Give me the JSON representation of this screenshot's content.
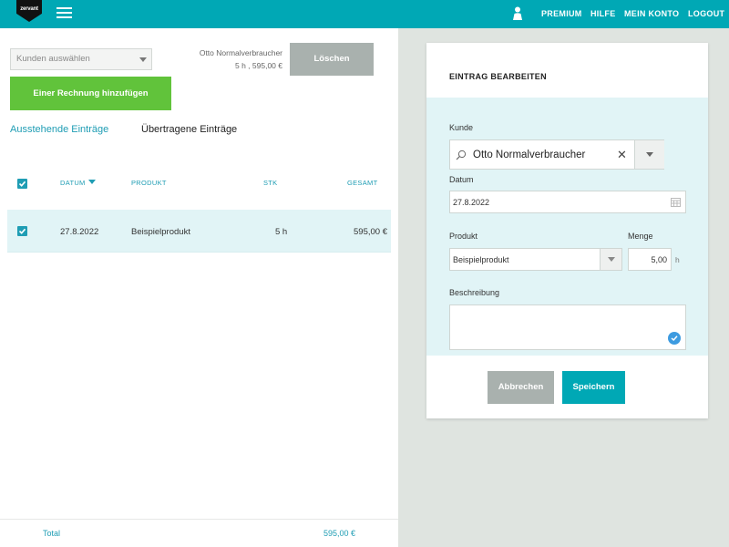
{
  "header": {
    "logo_text": "zervant",
    "nav": {
      "premium": "PREMIUM",
      "help": "HILFE",
      "account": "MEIN KONTO",
      "logout": "LOGOUT"
    },
    "background_color": "#00a8b5"
  },
  "left_panel": {
    "customer_select": {
      "placeholder": "Kunden auswählen"
    },
    "selection_info": {
      "customer": "Otto Normalverbraucher",
      "summary": "5 h , 595,00 €"
    },
    "delete_button": "Löschen",
    "add_invoice_button": "Einer Rechnung hinzufügen",
    "tabs": {
      "pending": "Ausstehende Einträge",
      "transferred": "Übertragene Einträge"
    },
    "table": {
      "headers": {
        "date": "DATUM",
        "product": "PRODUKT",
        "qty": "STK",
        "total": "GESAMT"
      },
      "rows": [
        {
          "date": "27.8.2022",
          "product": "Beispielprodukt",
          "qty": "5 h",
          "total": "595,00 €",
          "checked": true
        }
      ]
    },
    "footer": {
      "total_label": "Total",
      "total_value": "595,00 €"
    }
  },
  "edit_card": {
    "title": "EINTRAG BEARBEITEN",
    "customer_label": "Kunde",
    "customer_value": "Otto Normalverbraucher",
    "date_label": "Datum",
    "date_value": "27.8.2022",
    "product_label": "Produkt",
    "product_value": "Beispielprodukt",
    "quantity_label": "Menge",
    "quantity_value": "5,00",
    "quantity_unit": "h",
    "description_label": "Beschreibung",
    "description_value": "",
    "cancel_button": "Abbrechen",
    "save_button": "Speichern"
  },
  "colors": {
    "accent": "#00a8b5",
    "link": "#1f9db4",
    "green": "#61c33b",
    "grey_button": "#a9b1ae",
    "selected_row": "#e1f4f6",
    "right_background": "#dfe4e0"
  },
  "icons": [
    "zervant-logo",
    "hamburger-menu-icon",
    "user-icon",
    "chevron-down-icon",
    "checkbox-checked-icon",
    "sort-desc-icon",
    "search-icon",
    "clear-icon",
    "calendar-icon",
    "check-circle-icon"
  ]
}
